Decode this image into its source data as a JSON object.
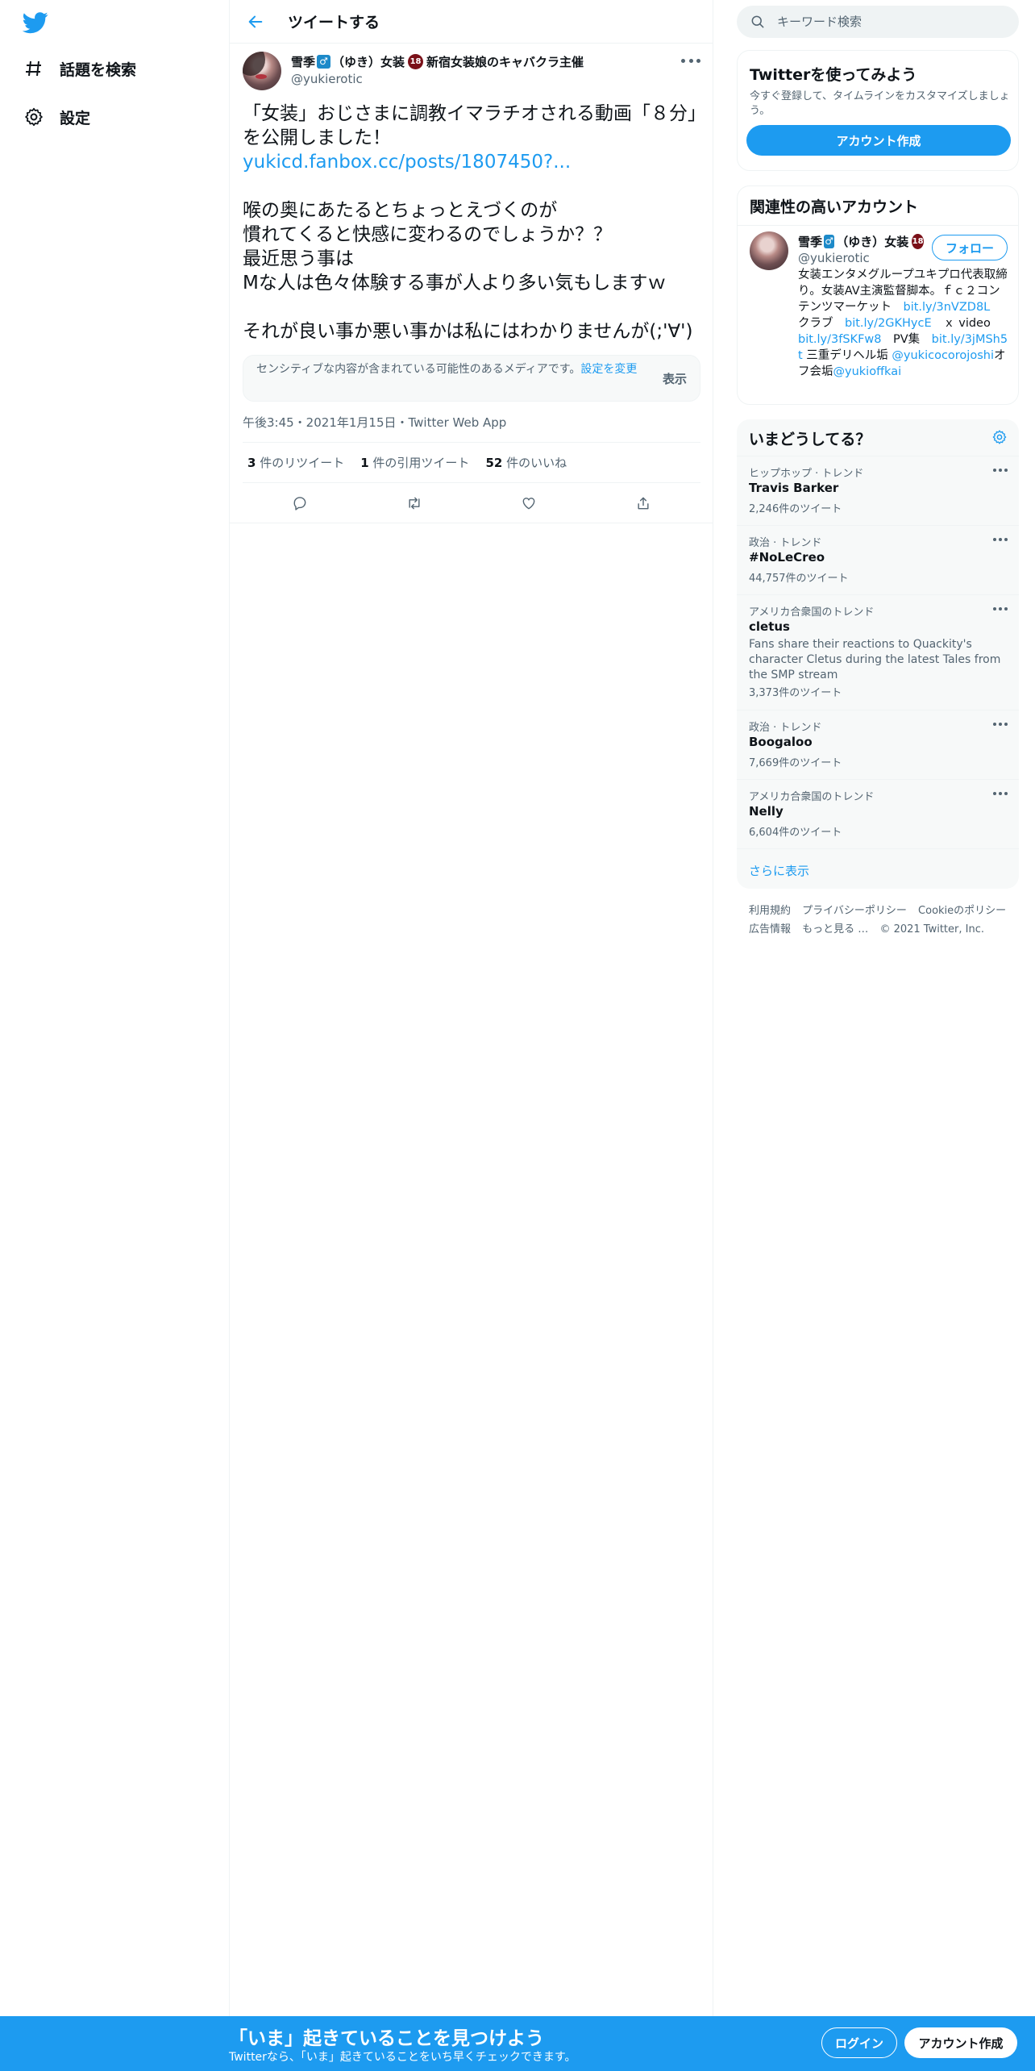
{
  "colors": {
    "accent": "#1d9bf0",
    "text": "#0f1419",
    "secondary": "#536471",
    "border": "#eff3f4",
    "badge_18": "#7a1018"
  },
  "sidebar": {
    "items": [
      {
        "label": "話題を検索",
        "icon": "hashtag-icon"
      },
      {
        "label": "設定",
        "icon": "gear-icon"
      }
    ]
  },
  "header": {
    "title": "ツイートする"
  },
  "tweet": {
    "author_name": "雪季",
    "author_badge": "♂",
    "author_name_suffix": "（ゆき）女装",
    "author_18": "18",
    "author_name_tail": "新宿女装娘のキャバクラ主催",
    "handle": "@yukierotic",
    "lines": [
      "「女装」おじさまに調教イマラチオされる動画「８分」を公開しました！",
      "",
      "",
      "喉の奥にあたるとちょっとえづくのが",
      "慣れてくると快感に変わるのでしょうか？？",
      "最近思う事は",
      "Mな人は色々体験する事が人より多い気もしますｗ",
      "",
      "それが良い事か悪い事かは私にはわかりませんが(;'∀')"
    ],
    "link": "yukicd.fanbox.cc/posts/1807450?...",
    "sensitive_text": "センシティブな内容が含まれている可能性のあるメディアです。",
    "sensitive_link": "設定を変更",
    "sensitive_button": "表示",
    "meta": "午後3:45・2021年1月15日・Twitter Web App",
    "stats": [
      {
        "count": "3",
        "label": " 件のリツイート"
      },
      {
        "count": "1",
        "label": " 件の引用ツイート"
      },
      {
        "count": "52",
        "label": " 件のいいね"
      }
    ]
  },
  "search": {
    "placeholder": "キーワード検索"
  },
  "try_card": {
    "title": "Twitterを使ってみよう",
    "subtitle": "今すぐ登録して、タイムラインをカスタマイズしましょう。",
    "button": "アカウント作成"
  },
  "related": {
    "title": "関連性の高いアカウント",
    "name": "雪季",
    "badge": "♂",
    "name_suffix": "（ゆき）女装",
    "badge18": "18",
    "handle": "@yukierotic",
    "follow": "フォロー",
    "bio_text1": "女装エンタメグループユキプロ代表取締り。女装AV主演監督脚本。ｆｃ２コンテンツマーケット　",
    "bio_link1": "bit.ly/3nVZD8L",
    "bio_text2": "　クラブ　",
    "bio_link2": "bit.ly/2GKHycE",
    "bio_text3": "　ｘ video　",
    "bio_link3": "bit.ly/3fSKFw8",
    "bio_text4": "　PV集　",
    "bio_link4": "bit.ly/3jMSh5t",
    "bio_text5": " 三重デリヘル垢 ",
    "bio_link5": "@yukicocorojoshi",
    "bio_text6": "オフ会垢",
    "bio_link6": "@yukioffkai"
  },
  "trends": {
    "title": "いまどうしてる？",
    "items": [
      {
        "context": "ヒップホップ · トレンド",
        "name": "Travis Barker",
        "description": "",
        "count": "2,246件のツイート"
      },
      {
        "context": "政治 · トレンド",
        "name": "#NoLeCreo",
        "description": "",
        "count": "44,757件のツイート"
      },
      {
        "context": "アメリカ合衆国のトレンド",
        "name": "cletus",
        "description": "Fans share their reactions to Quackity's character Cletus during the latest Tales from the SMP stream",
        "count": "3,373件のツイート"
      },
      {
        "context": "政治 · トレンド",
        "name": "Boogaloo",
        "description": "",
        "count": "7,669件のツイート"
      },
      {
        "context": "アメリカ合衆国のトレンド",
        "name": "Nelly",
        "description": "",
        "count": "6,604件のツイート"
      }
    ],
    "show_more": "さらに表示"
  },
  "footer": {
    "links": [
      "利用規約",
      "プライバシーポリシー",
      "Cookieのポリシー",
      "広告情報",
      "もっと見る …",
      "© 2021 Twitter, Inc."
    ]
  },
  "bottom_bar": {
    "title": "「いま」起きていることを見つけよう",
    "subtitle": "Twitterなら、「いま」起きていることをいち早くチェックできます。",
    "login": "ログイン",
    "signup": "アカウント作成"
  }
}
